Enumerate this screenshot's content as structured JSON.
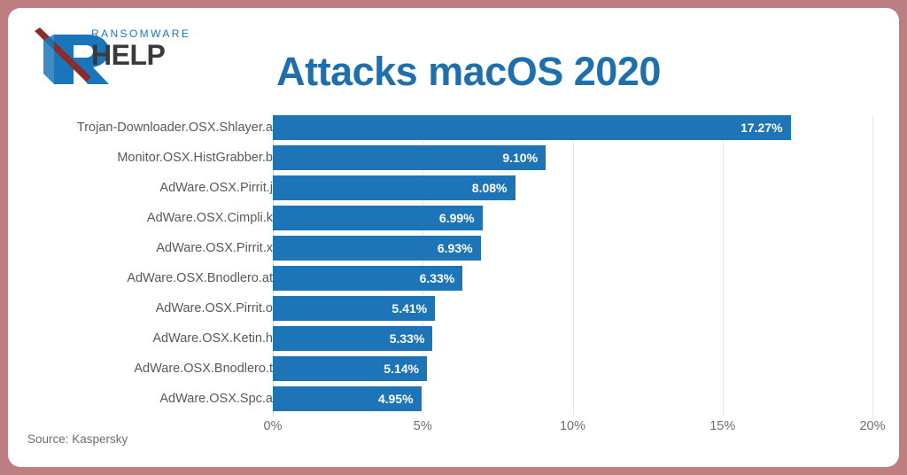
{
  "frame": {
    "border_color": "#bc7e80",
    "card_background": "#ffffff"
  },
  "logo": {
    "name": "ransomware-help-logo",
    "line1": "RANSOMWARE",
    "line2": "HELP",
    "letter": "R",
    "blue": "#1b75bb",
    "dark_red": "#8c2b2b",
    "text_dark": "#3a3a3a"
  },
  "header": {
    "title": "Attacks macOS 2020",
    "title_color": "#1f6fad"
  },
  "footer": {
    "source": "Source: Kaspersky"
  },
  "chart_data": {
    "type": "bar",
    "orientation": "horizontal",
    "title": "Attacks macOS 2020",
    "subtitle": "",
    "xlabel": "",
    "ylabel": "",
    "xlim": [
      0,
      20
    ],
    "grid": true,
    "grid_axis": "x",
    "legend": false,
    "legend_position": "none",
    "bar_color": "#1d74b7",
    "value_label_format": "0.00%",
    "value_label_position": "inside-end",
    "xtick_labels": [
      "0%",
      "5%",
      "10%",
      "15%",
      "20%"
    ],
    "xtick_values": [
      0,
      5,
      10,
      15,
      20
    ],
    "categories": [
      "Trojan-Downloader.OSX.Shlayer.a",
      "Monitor.OSX.HistGrabber.b",
      "AdWare.OSX.Pirrit.j",
      "AdWare.OSX.Cimpli.k",
      "AdWare.OSX.Pirrit.x",
      "AdWare.OSX.Bnodlero.at",
      "AdWare.OSX.Pirrit.o",
      "AdWare.OSX.Ketin.h",
      "AdWare.OSX.Bnodlero.t",
      "AdWare.OSX.Spc.a"
    ],
    "values": [
      17.27,
      9.1,
      8.08,
      6.99,
      6.93,
      6.33,
      5.41,
      5.33,
      5.14,
      4.95
    ],
    "value_labels": [
      "17.27%",
      "9.10%",
      "8.08%",
      "6.99%",
      "6.93%",
      "6.33%",
      "5.41%",
      "5.33%",
      "5.14%",
      "4.95%"
    ]
  }
}
